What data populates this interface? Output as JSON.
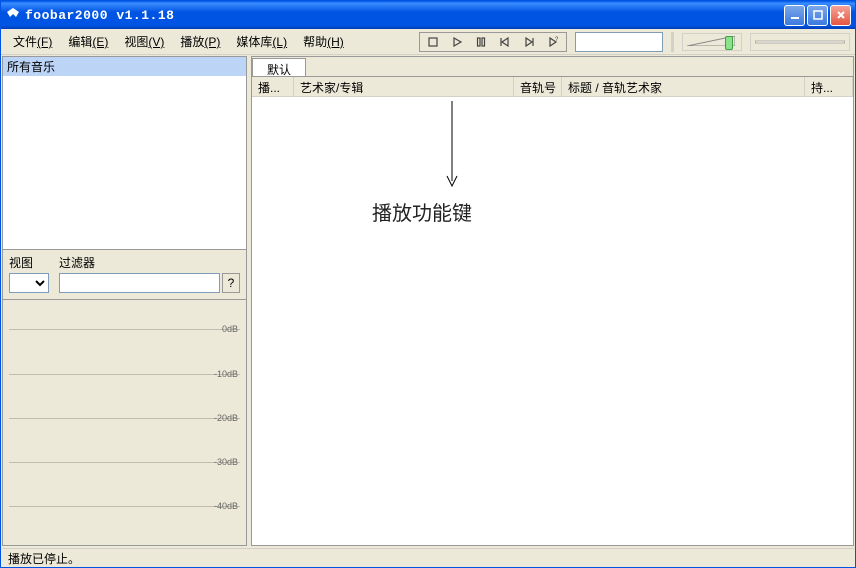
{
  "window": {
    "title": "foobar2000 v1.1.18"
  },
  "menu": {
    "file": "文件",
    "file_accel": "(F)",
    "edit": "编辑",
    "edit_accel": "(E)",
    "view": "视图",
    "view_accel": "(V)",
    "playback": "播放",
    "playback_accel": "(P)",
    "library": "媒体库",
    "library_accel": "(L)",
    "help": "帮助",
    "help_accel": "(H)"
  },
  "sidebar": {
    "all_music": "所有音乐",
    "view_label": "视图",
    "filter_label": "过滤器",
    "view_value": "",
    "filter_value": "",
    "help_btn": "?"
  },
  "viz": {
    "db_labels": [
      "0dB",
      "-10dB",
      "-20dB",
      "-30dB",
      "-40dB"
    ]
  },
  "tabs": {
    "default": "默认"
  },
  "columns": {
    "playing": "播...",
    "artist_album": "艺术家/专辑",
    "track_no": "音轨号",
    "title_artist": "标题 / 音轨艺术家",
    "duration": "持..."
  },
  "annotation": {
    "label": "播放功能键"
  },
  "status": {
    "text": "播放已停止。"
  },
  "icons": {
    "stop": "stop",
    "play": "play",
    "pause": "pause",
    "prev": "prev",
    "next": "next",
    "random": "random"
  }
}
